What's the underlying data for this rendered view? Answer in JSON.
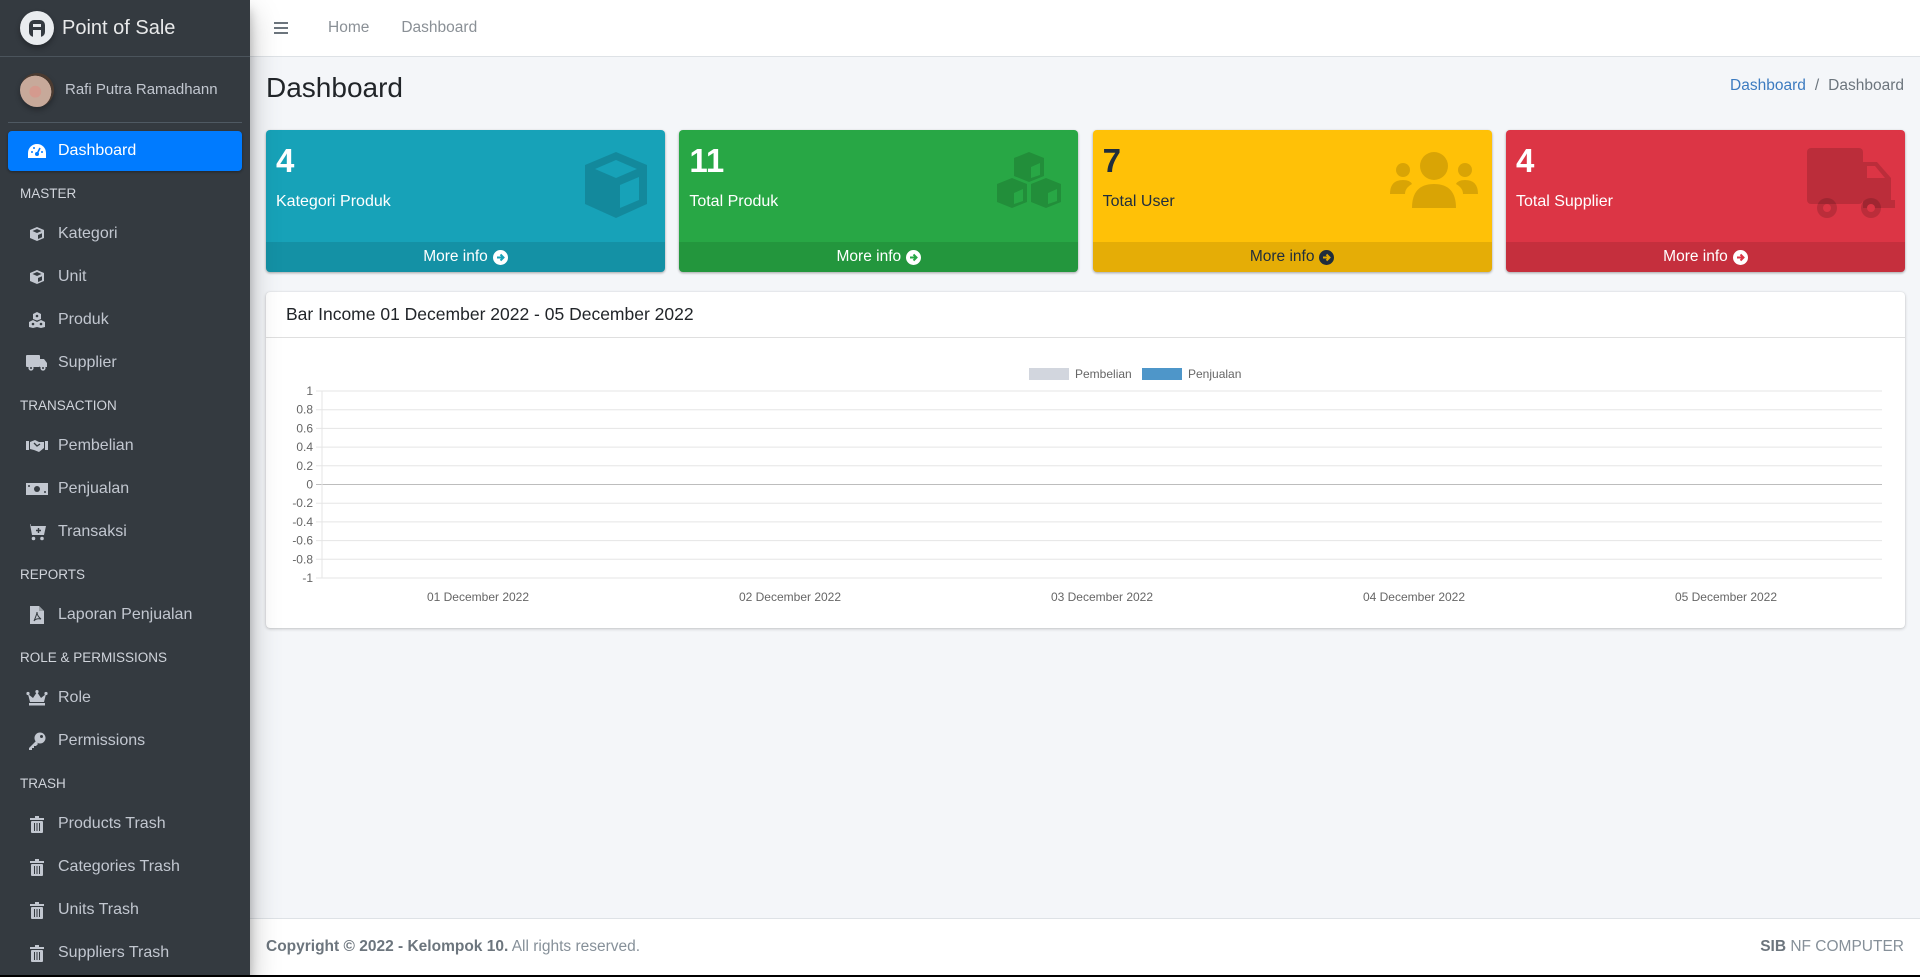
{
  "app": {
    "brand": "Point of Sale"
  },
  "user": {
    "name": "Rafi Putra Ramadhann"
  },
  "sidebar": {
    "items": [
      {
        "type": "item",
        "label": "Dashboard",
        "icon": "tachometer-icon",
        "active": true
      },
      {
        "type": "header",
        "label": "MASTER"
      },
      {
        "type": "item",
        "label": "Kategori",
        "icon": "cube-icon"
      },
      {
        "type": "item",
        "label": "Unit",
        "icon": "cube-icon"
      },
      {
        "type": "item",
        "label": "Produk",
        "icon": "cubes-icon"
      },
      {
        "type": "item",
        "label": "Supplier",
        "icon": "truck-icon"
      },
      {
        "type": "header",
        "label": "TRANSACTION"
      },
      {
        "type": "item",
        "label": "Pembelian",
        "icon": "handshake-icon"
      },
      {
        "type": "item",
        "label": "Penjualan",
        "icon": "money-bill-icon"
      },
      {
        "type": "item",
        "label": "Transaksi",
        "icon": "cart-plus-icon"
      },
      {
        "type": "header",
        "label": "REPORTS"
      },
      {
        "type": "item",
        "label": "Laporan Penjualan",
        "icon": "file-pdf-icon"
      },
      {
        "type": "header",
        "label": "ROLE & PERMISSIONS"
      },
      {
        "type": "item",
        "label": "Role",
        "icon": "crown-icon"
      },
      {
        "type": "item",
        "label": "Permissions",
        "icon": "key-icon"
      },
      {
        "type": "header",
        "label": "TRASH"
      },
      {
        "type": "item",
        "label": "Products Trash",
        "icon": "trash-icon"
      },
      {
        "type": "item",
        "label": "Categories Trash",
        "icon": "trash-icon"
      },
      {
        "type": "item",
        "label": "Units Trash",
        "icon": "trash-icon"
      },
      {
        "type": "item",
        "label": "Suppliers Trash",
        "icon": "trash-icon"
      }
    ]
  },
  "topbar": {
    "links": [
      "Home",
      "Dashboard"
    ]
  },
  "page": {
    "title": "Dashboard",
    "breadcrumb": {
      "parent": "Dashboard",
      "separator": "/",
      "current": "Dashboard"
    }
  },
  "stats": [
    {
      "value": "4",
      "label": "Kategori Produk",
      "more": "More info",
      "icon": "cube-icon",
      "color": "#17a2b8"
    },
    {
      "value": "11",
      "label": "Total Produk",
      "more": "More info",
      "icon": "cubes-icon",
      "color": "#28a745"
    },
    {
      "value": "7",
      "label": "Total User",
      "more": "More info",
      "icon": "users-icon",
      "color": "#ffc107"
    },
    {
      "value": "4",
      "label": "Total Supplier",
      "more": "More info",
      "icon": "truck-icon",
      "color": "#dc3545"
    }
  ],
  "chart_card": {
    "title": "Bar Income 01 December 2022 - 05 December 2022"
  },
  "chart_data": {
    "type": "bar",
    "title": "Bar Income 01 December 2022 - 05 December 2022",
    "categories": [
      "01 December 2022",
      "02 December 2022",
      "03 December 2022",
      "04 December 2022",
      "05 December 2022"
    ],
    "series": [
      {
        "name": "Pembelian",
        "color": "#d2d6de",
        "values": [
          0,
          0,
          0,
          0,
          0
        ]
      },
      {
        "name": "Penjualan",
        "color": "#4e96c9",
        "values": [
          0,
          0,
          0,
          0,
          0
        ]
      }
    ],
    "ylim": [
      -1,
      1
    ],
    "yticks": [
      1,
      0.8,
      0.6,
      0.4,
      0.2,
      0,
      -0.2,
      -0.4,
      -0.6,
      -0.8,
      -1
    ],
    "xlabel": "",
    "ylabel": "",
    "grid": true,
    "legend": "top-center"
  },
  "footer": {
    "copyright_bold": "Copyright © 2022 - Kelompok 10.",
    "copyright_rest": " All rights reserved.",
    "right_bold": "SIB",
    "right_rest": " NF COMPUTER"
  }
}
